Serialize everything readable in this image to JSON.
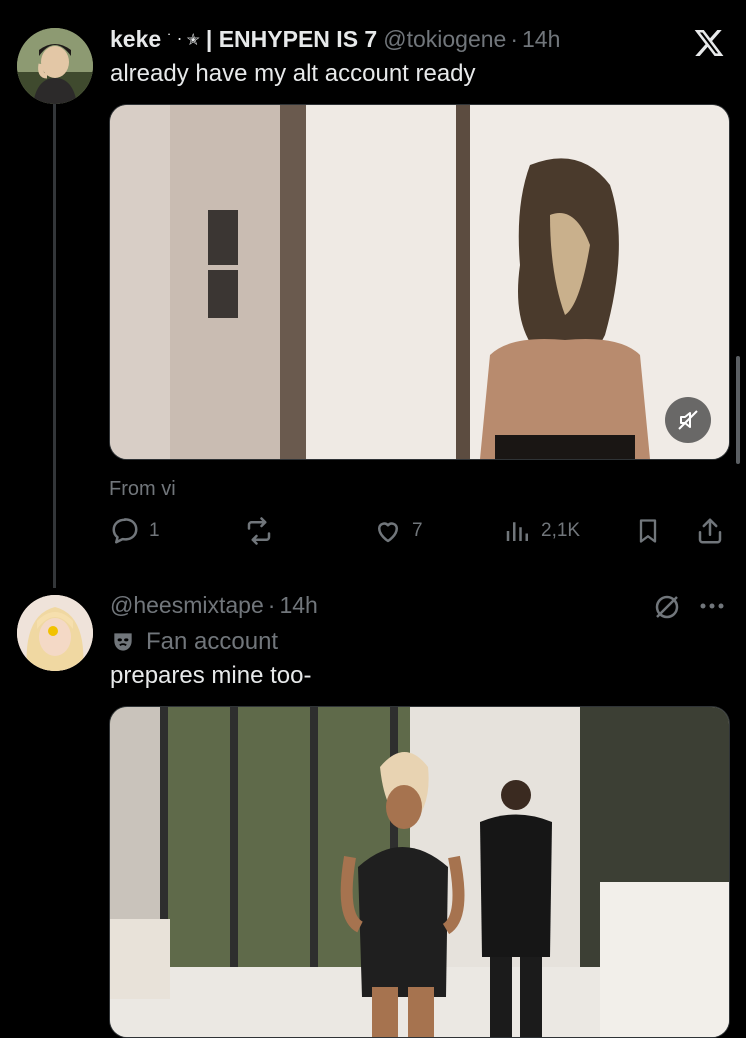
{
  "colors": {
    "background": "#000000",
    "text_primary": "#e7e9ea",
    "text_secondary": "#71767b",
    "divider": "#2f3336"
  },
  "brand": {
    "icon": "x-logo-icon"
  },
  "tweet1": {
    "author_name": "keke",
    "author_emoji": "˙ ‧ ✭",
    "author_name_suffix": "| ENHYPEN IS 7",
    "handle": "@tokiogene",
    "separator": "·",
    "time": "14h",
    "text": "already have my alt account ready",
    "media_type": "video",
    "media_icon": "muted-speaker-icon",
    "source_label": "From vi",
    "actions": {
      "replies": "1",
      "reposts": "",
      "likes": "7",
      "views": "2,1K"
    }
  },
  "tweet2": {
    "handle": "@heesmixtape",
    "separator": "·",
    "time": "14h",
    "account_label_icon": "mask-icon",
    "account_label": "Fan account",
    "text": "prepares mine too-",
    "media_type": "video"
  }
}
